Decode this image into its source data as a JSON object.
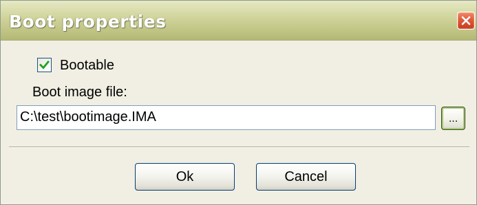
{
  "window": {
    "title": "Boot properties",
    "close_icon": "close-icon"
  },
  "bootable": {
    "label": "Bootable",
    "checked": true
  },
  "image_file": {
    "label": "Boot image file:",
    "value": "C:\\test\\bootimage.IMA",
    "browse_label": "..."
  },
  "buttons": {
    "ok": "Ok",
    "cancel": "Cancel"
  },
  "colors": {
    "titlebar": "#c3c787",
    "window_bg": "#f1efe3",
    "close": "#e05a3a",
    "check": "#21a121"
  }
}
